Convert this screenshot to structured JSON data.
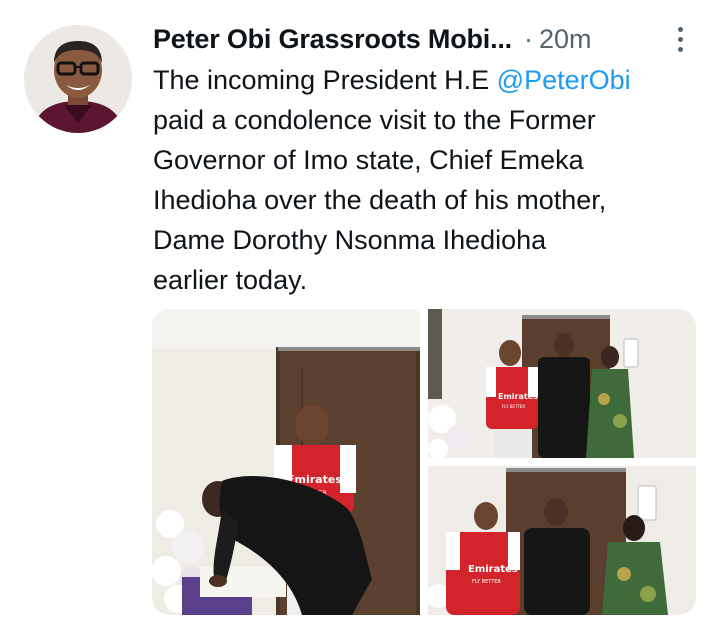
{
  "tweet": {
    "author_name": "Peter Obi Grassroots Mobi...",
    "separator": "·",
    "time": "20m",
    "text_lines": [
      [
        "The incoming President H.E ",
        "@PeterObi"
      ],
      [
        "paid a condolence visit to the Former"
      ],
      [
        "Governor of Imo state, Chief Emeka"
      ],
      [
        "Ihedioha over the death of his mother,"
      ],
      [
        "Dame Dorothy Nsonma Ihedioha"
      ],
      [
        "earlier today."
      ]
    ],
    "mention_color": "#1d9bf0"
  },
  "media": {
    "photos": [
      {
        "jersey_sponsor": "Emirates",
        "jersey_sub": "FLY BETTER"
      },
      {
        "jersey_sponsor": "Emirates",
        "jersey_sub": "FLY BETTER"
      },
      {
        "jersey_sponsor": "Emirates",
        "jersey_sub": "FLY BETTER"
      }
    ]
  },
  "icons": {
    "more": "more-vertical-icon"
  }
}
